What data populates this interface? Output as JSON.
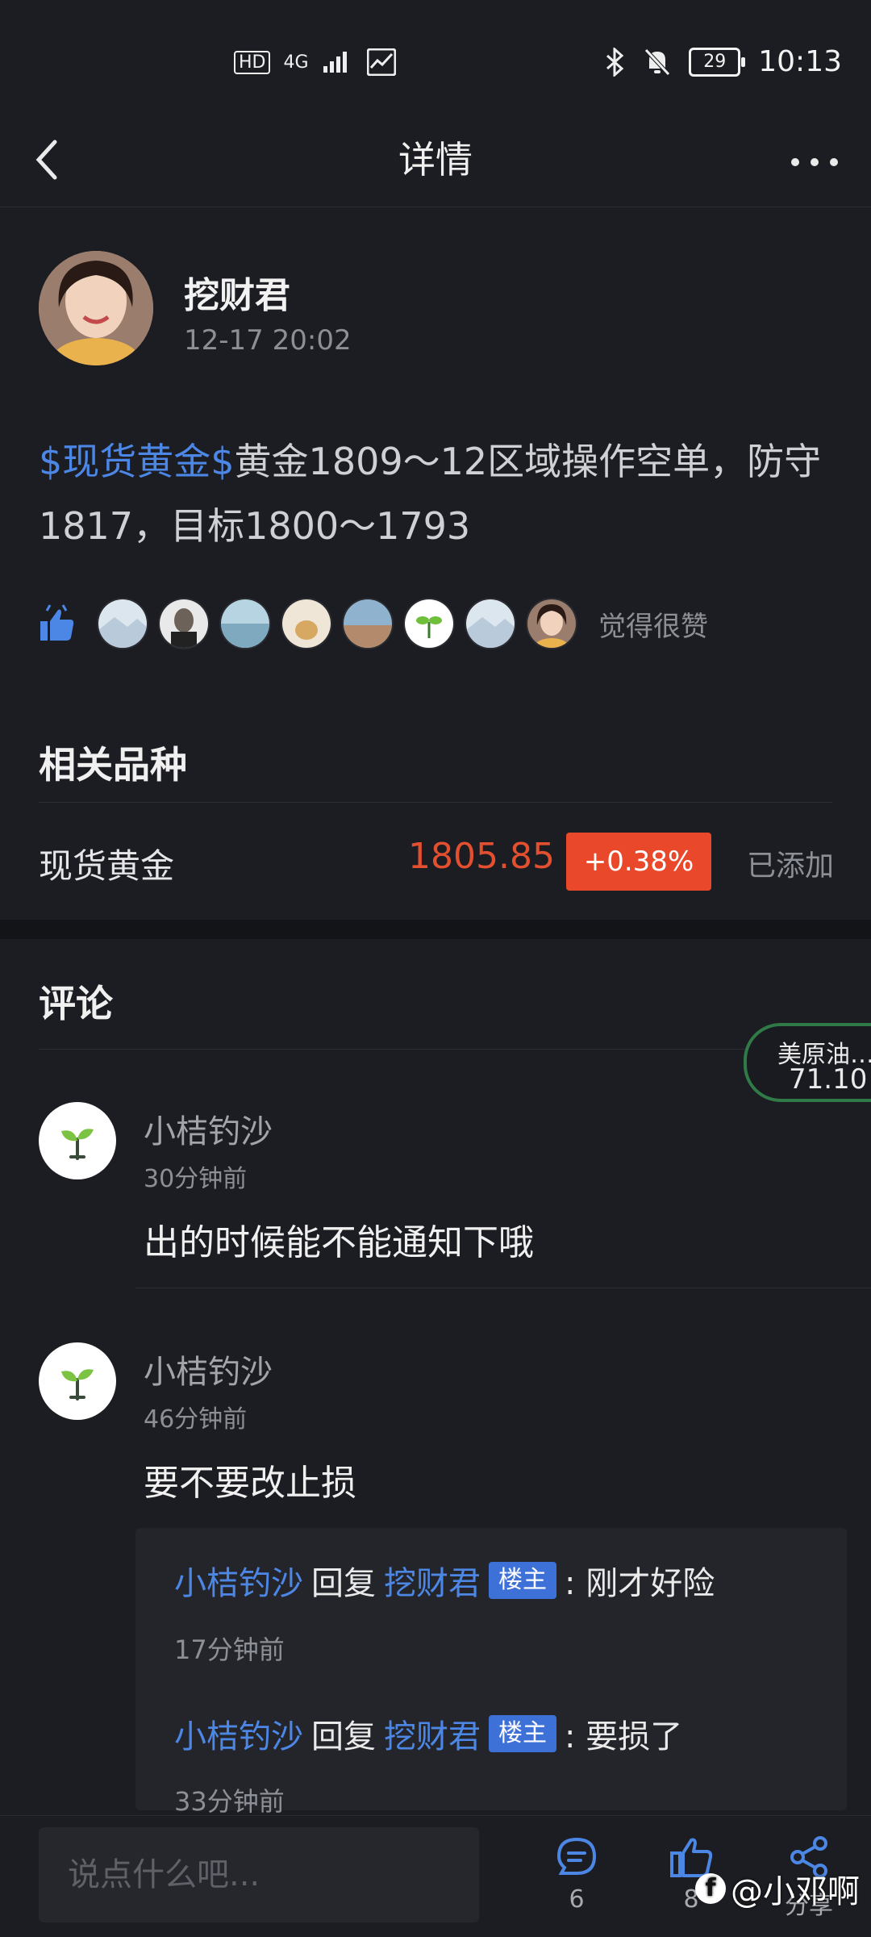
{
  "status_bar": {
    "network_hd": "HD",
    "network_gen": "4G",
    "time": "10:13",
    "battery": "29"
  },
  "nav": {
    "title": "详情",
    "back_icon": "back-chevron-icon",
    "more_icon": "more-dots-icon"
  },
  "post": {
    "author": "挖财君",
    "time": "12-17 20:02",
    "tag": "$现货黄金$",
    "body": "黄金1809～12区域操作空单，防守1817，目标1800～1793",
    "likes_text": "觉得很赞"
  },
  "related": {
    "title": "相关品种",
    "instrument": {
      "name": "现货黄金",
      "price": "1805.85",
      "change": "+0.38%",
      "status": "已添加"
    }
  },
  "ticker": {
    "name": "美原油…",
    "value": "71.10"
  },
  "comments": {
    "title": "评论",
    "items": [
      {
        "user": "小桔钓沙",
        "time": "30分钟前",
        "text": "出的时候能不能通知下哦"
      },
      {
        "user": "小桔钓沙",
        "time": "46分钟前",
        "text": "要不要改止损"
      }
    ],
    "replies": [
      {
        "from": "小桔钓沙",
        "verb": "回复",
        "to": "挖财君",
        "badge": "楼主",
        "text": ": 刚才好险",
        "time": "17分钟前"
      },
      {
        "from": "小桔钓沙",
        "verb": "回复",
        "to": "挖财君",
        "badge": "楼主",
        "text": ": 要损了",
        "time": "33分钟前"
      }
    ]
  },
  "bottom_bar": {
    "input_placeholder": "说点什么吧...",
    "comment_count": "6",
    "like_count": "8",
    "share_label": "分享"
  },
  "watermark": "@小邓啊",
  "colors": {
    "background": "#1c1d22",
    "accent_blue": "#4c87e6",
    "price_red": "#e4502f",
    "change_badge": "#e9482a"
  }
}
